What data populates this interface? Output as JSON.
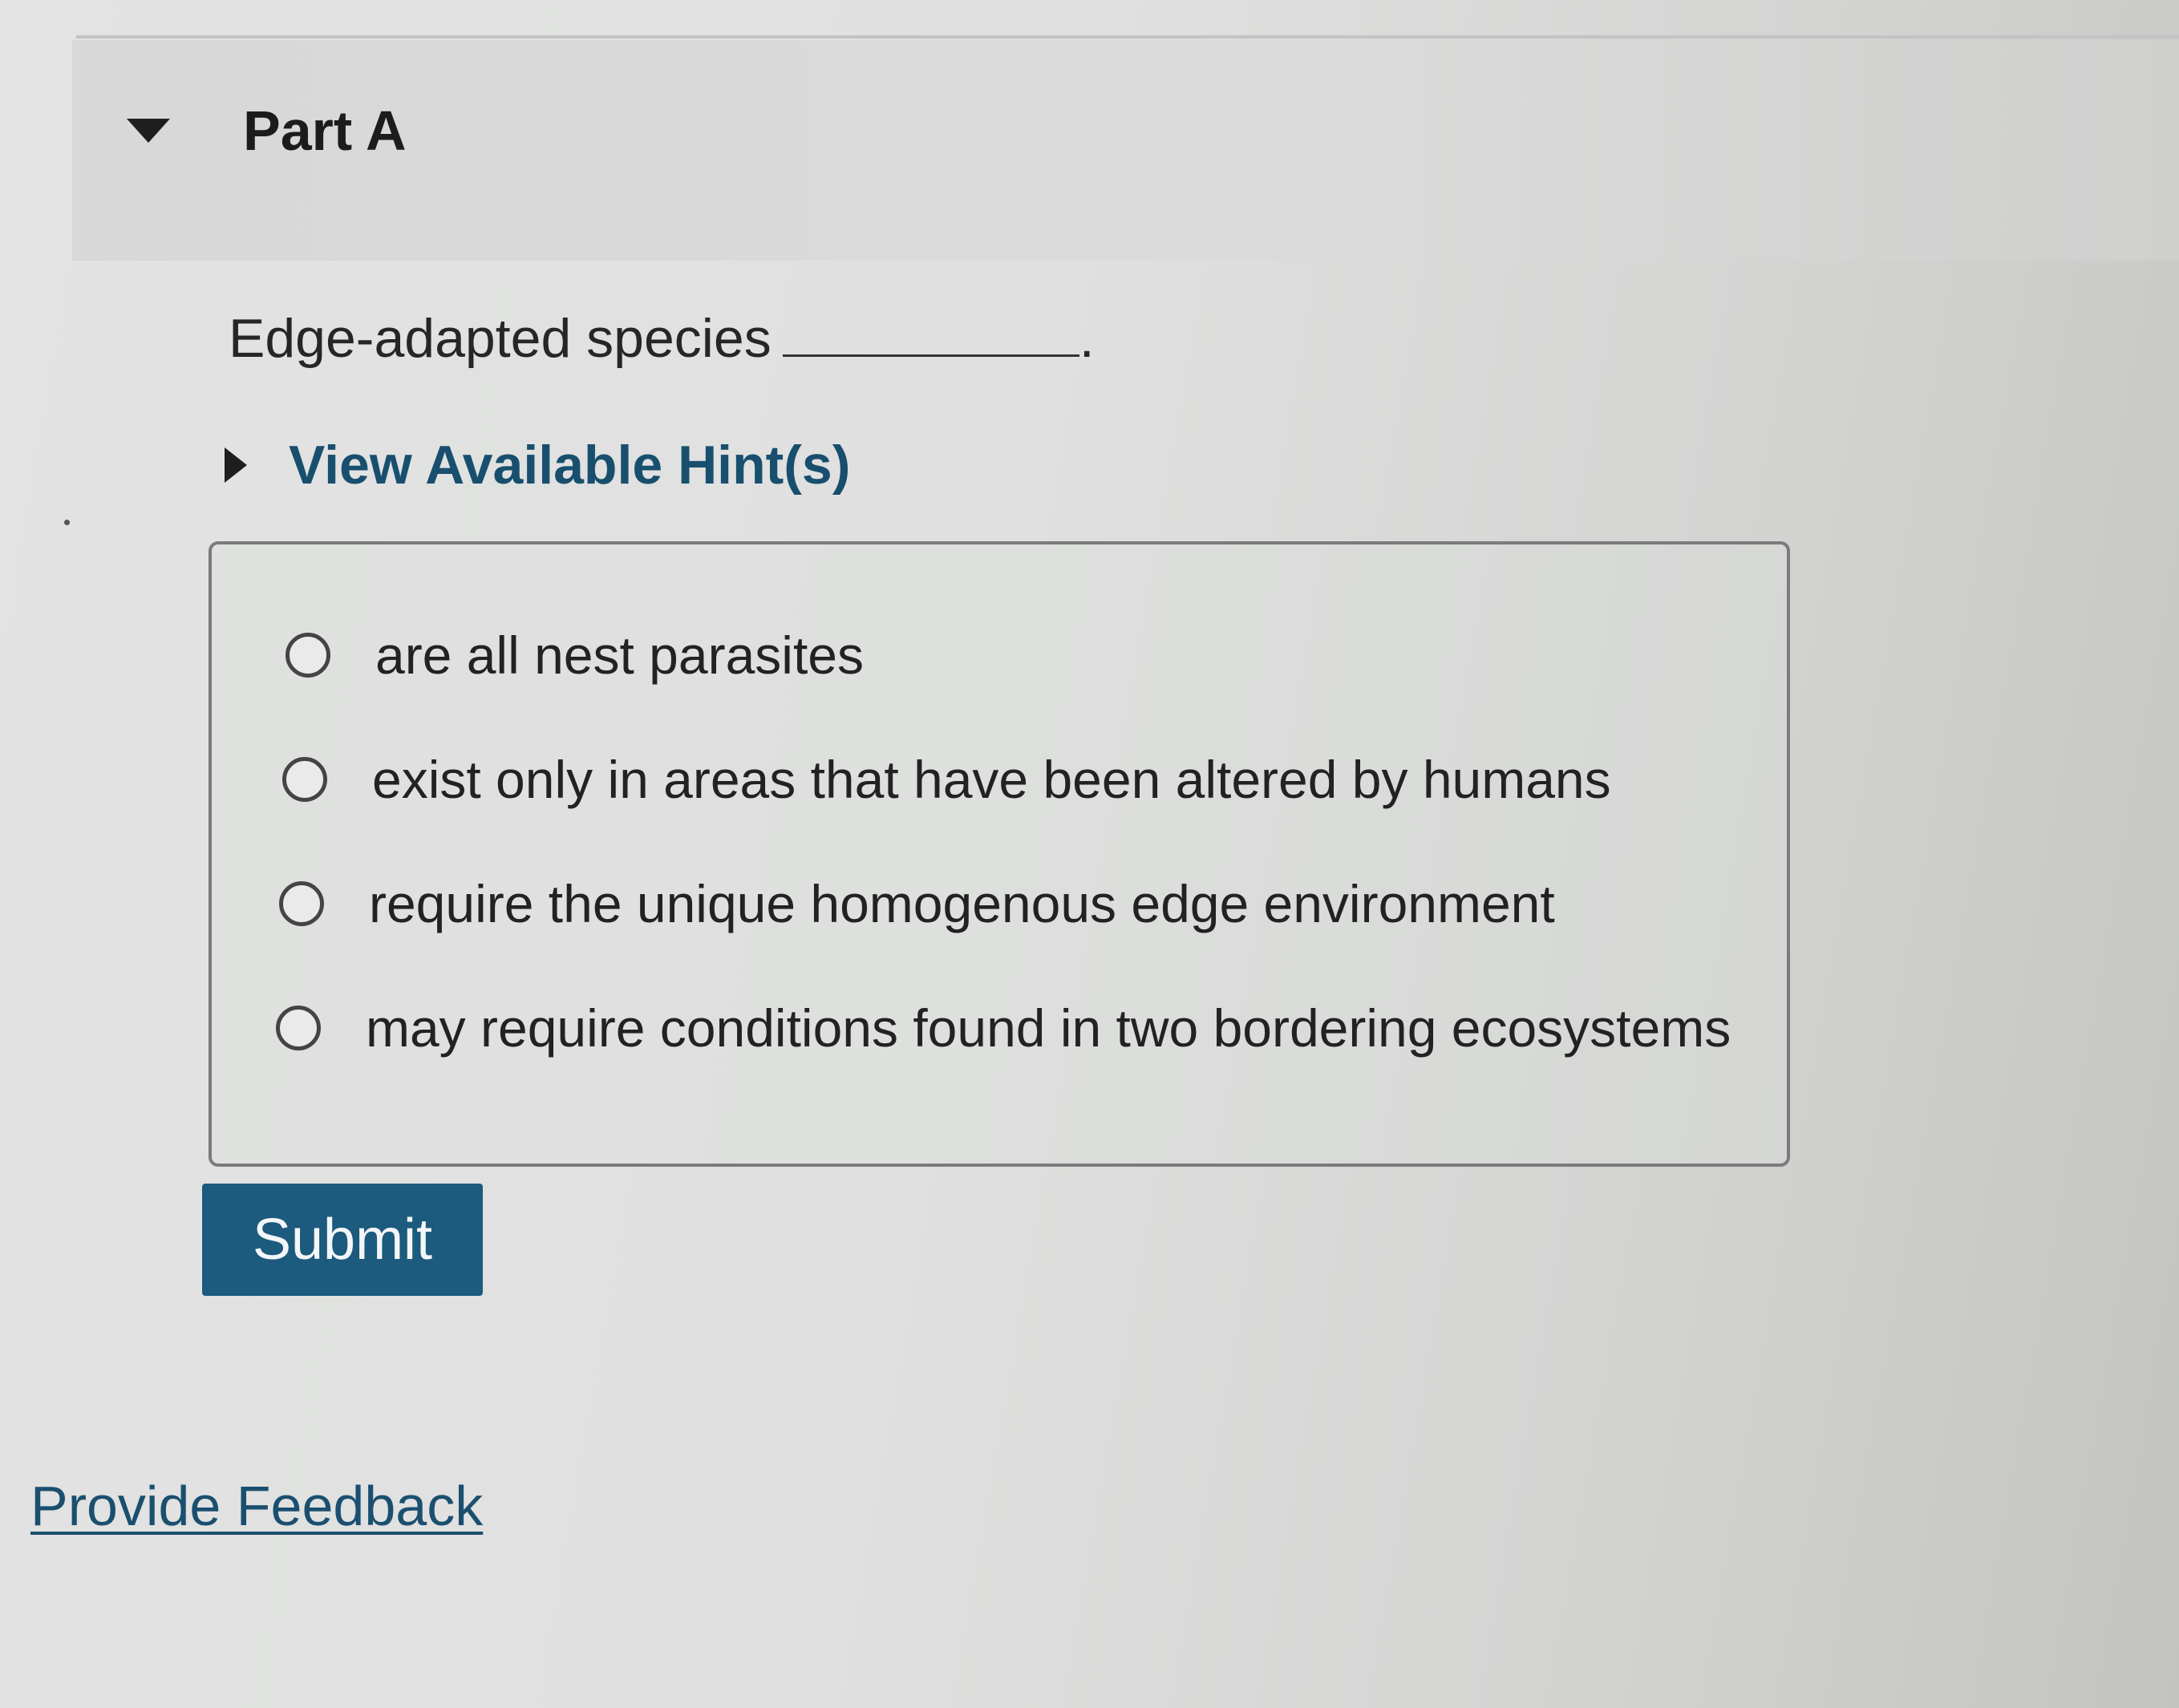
{
  "part": {
    "title": "Part A",
    "toggle_icon": "triangle-down-icon"
  },
  "question": {
    "text": "Edge-adapted species",
    "end_punctuation": "."
  },
  "hints": {
    "label": "View Available Hint(s)",
    "toggle_icon": "triangle-right-icon"
  },
  "options": [
    {
      "label": "are all nest parasites",
      "selected": false
    },
    {
      "label": "exist only in areas that have been altered by humans",
      "selected": false
    },
    {
      "label": "require the unique homogenous edge environment",
      "selected": false
    },
    {
      "label": "may require conditions found in two bordering ecosystems",
      "selected": false
    }
  ],
  "submit": {
    "label": "Submit"
  },
  "feedback": {
    "label": "Provide Feedback"
  },
  "colors": {
    "button_bg": "#1c5a7e",
    "link": "#184f6e",
    "text": "#222222"
  }
}
